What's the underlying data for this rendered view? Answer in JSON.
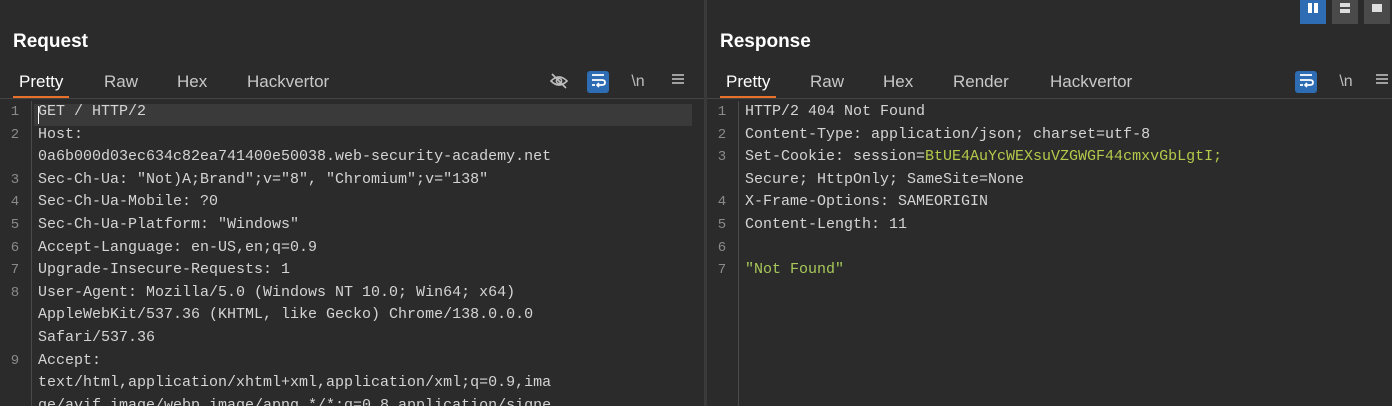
{
  "request": {
    "title": "Request",
    "tabs": [
      "Pretty",
      "Raw",
      "Hex",
      "Hackvertor"
    ],
    "active_tab": "Pretty",
    "tools": {
      "hide_icon": "eye-slash-icon",
      "wrap_icon": "wrap-icon",
      "newline_label": "\\n",
      "menu_icon": "menu-icon"
    },
    "lines": [
      {
        "n": "1",
        "text": "GET / HTTP/2"
      },
      {
        "n": "2",
        "text": "Host:"
      },
      {
        "n": "",
        "text": "0a6b000d03ec634c82ea741400e50038.web-security-academy.net"
      },
      {
        "n": "3",
        "text": "Sec-Ch-Ua: \"Not)A;Brand\";v=\"8\", \"Chromium\";v=\"138\""
      },
      {
        "n": "4",
        "text": "Sec-Ch-Ua-Mobile: ?0"
      },
      {
        "n": "5",
        "text": "Sec-Ch-Ua-Platform: \"Windows\""
      },
      {
        "n": "6",
        "text": "Accept-Language: en-US,en;q=0.9"
      },
      {
        "n": "7",
        "text": "Upgrade-Insecure-Requests: 1"
      },
      {
        "n": "8",
        "text": "User-Agent: Mozilla/5.0 (Windows NT 10.0; Win64; x64)"
      },
      {
        "n": "",
        "text": "AppleWebKit/537.36 (KHTML, like Gecko) Chrome/138.0.0.0"
      },
      {
        "n": "",
        "text": "Safari/537.36"
      },
      {
        "n": "9",
        "text": "Accept:"
      },
      {
        "n": "",
        "text": "text/html,application/xhtml+xml,application/xml;q=0.9,ima"
      },
      {
        "n": "",
        "text": "ge/avif,image/webp,image/apng,*/*;q=0.8,application/signe"
      }
    ]
  },
  "response": {
    "title": "Response",
    "tabs": [
      "Pretty",
      "Raw",
      "Hex",
      "Render",
      "Hackvertor"
    ],
    "active_tab": "Pretty",
    "tools": {
      "wrap_icon": "wrap-icon",
      "newline_label": "\\n",
      "menu_icon": "menu-icon"
    },
    "lines": [
      {
        "n": "1",
        "text": "HTTP/2 404 Not Found"
      },
      {
        "n": "2",
        "text": "Content-Type: application/json; charset=utf-8"
      },
      {
        "n": "3",
        "key": "Set-Cookie: session=",
        "value": "BtUE4AuYcWEXsuVZGWGF44cmxvGbLgtI;"
      },
      {
        "n": "",
        "text": "Secure; HttpOnly; SameSite=None"
      },
      {
        "n": "4",
        "text": "X-Frame-Options: SAMEORIGIN"
      },
      {
        "n": "5",
        "text": "Content-Length: 11"
      },
      {
        "n": "6",
        "text": ""
      },
      {
        "n": "7",
        "string": "\"Not Found\""
      }
    ]
  },
  "layout_buttons": [
    "split-vertical-icon",
    "split-horizontal-icon",
    "single-pane-icon"
  ],
  "colors": {
    "accent_tab": "#e8702a",
    "active_tool": "#2e6db4",
    "cookie_value": "#b5c94b"
  }
}
